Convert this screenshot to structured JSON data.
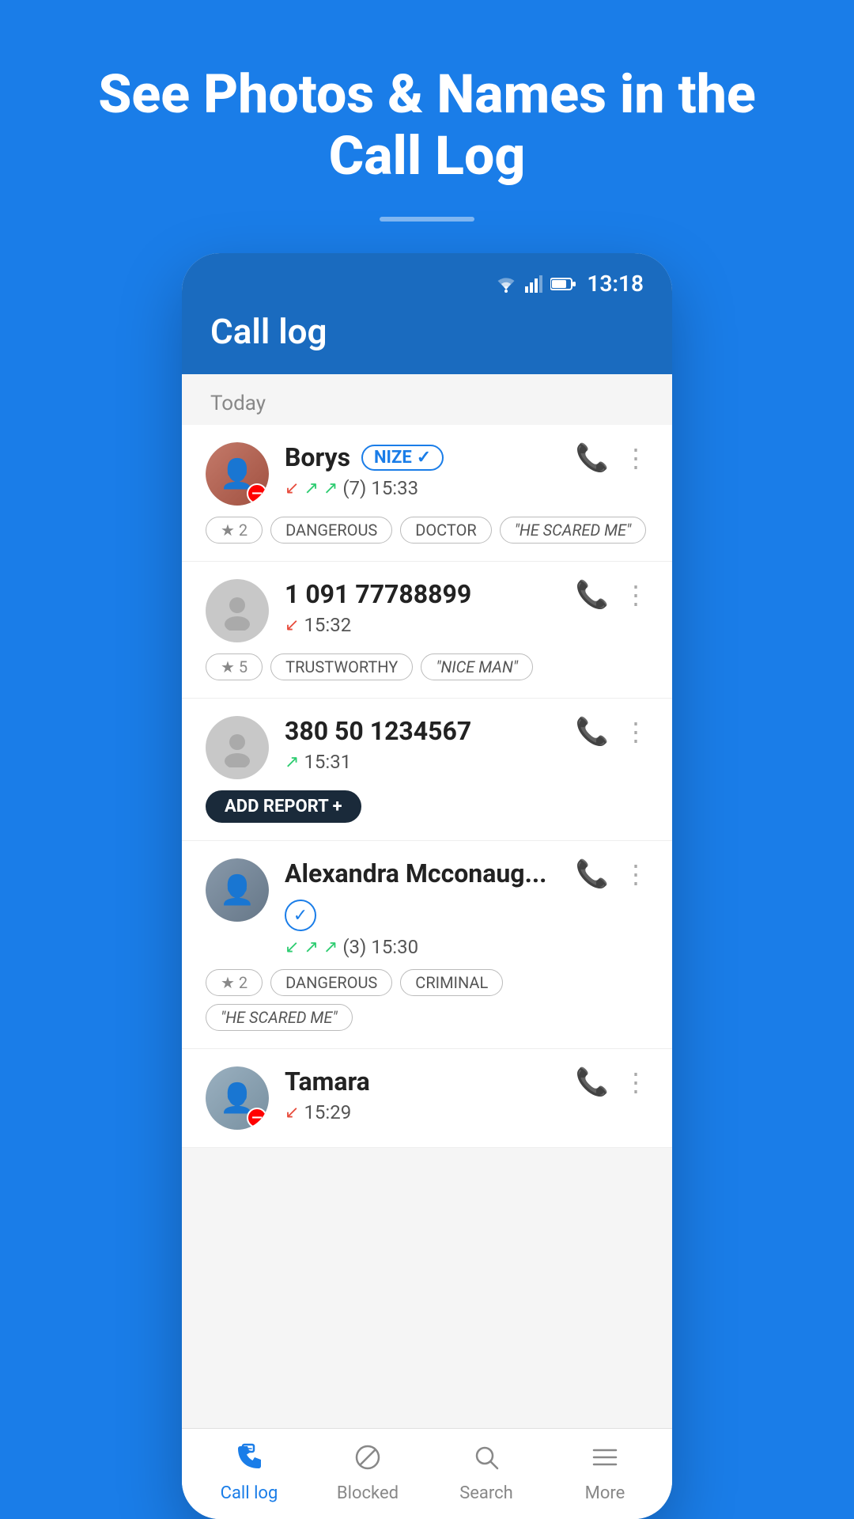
{
  "hero": {
    "title": "See Photos & Names in the Call Log"
  },
  "phone": {
    "statusBar": {
      "time": "13:18"
    },
    "header": {
      "title": "Call log"
    },
    "sectionLabel": "Today",
    "callItems": [
      {
        "id": "borys",
        "name": "Borys",
        "badge": "NIZE ✓",
        "hasBadge": true,
        "badgeType": "nize",
        "isBlocked": true,
        "callMeta": "(7) 15:33",
        "callTypes": [
          "missed-in",
          "out",
          "out"
        ],
        "tags": [
          {
            "type": "star",
            "value": "★ 2"
          },
          {
            "type": "label",
            "value": "DANGEROUS"
          },
          {
            "type": "label",
            "value": "DOCTOR"
          },
          {
            "type": "quote",
            "value": "\"HE SCARED ME\""
          }
        ],
        "hasAvatar": true,
        "avatarType": "borys"
      },
      {
        "id": "unknown1",
        "name": "1 091 77788899",
        "badge": null,
        "hasBadge": false,
        "isBlocked": false,
        "callMeta": "15:32",
        "callTypes": [
          "missed-in"
        ],
        "tags": [
          {
            "type": "star",
            "value": "★ 5"
          },
          {
            "type": "label",
            "value": "TRUSTWORTHY"
          },
          {
            "type": "quote",
            "value": "\"NICE MAN\""
          }
        ],
        "hasAvatar": false,
        "avatarType": "generic"
      },
      {
        "id": "unknown2",
        "name": "380 50 1234567",
        "badge": null,
        "hasBadge": false,
        "isBlocked": false,
        "callMeta": "15:31",
        "callTypes": [
          "out"
        ],
        "tags": [],
        "hasAddReport": true,
        "addReportLabel": "ADD REPORT +",
        "hasAvatar": false,
        "avatarType": "generic"
      },
      {
        "id": "alexandra",
        "name": "Alexandra Mcconaug...",
        "badge": "✓",
        "hasBadge": true,
        "badgeType": "verified",
        "isBlocked": false,
        "callMeta": "(3) 15:30",
        "callTypes": [
          "in",
          "out",
          "out"
        ],
        "tags": [
          {
            "type": "star",
            "value": "★ 2"
          },
          {
            "type": "label",
            "value": "DANGEROUS"
          },
          {
            "type": "label",
            "value": "CRIMINAL"
          },
          {
            "type": "quote",
            "value": "\"HE SCARED ME\""
          }
        ],
        "hasAvatar": true,
        "avatarType": "alexandra"
      },
      {
        "id": "tamara",
        "name": "Tamara",
        "badge": null,
        "hasBadge": false,
        "isBlocked": true,
        "callMeta": "15:29",
        "callTypes": [
          "missed-in"
        ],
        "tags": [],
        "hasAvatar": true,
        "avatarType": "tamara"
      }
    ],
    "bottomNav": [
      {
        "id": "calllog",
        "label": "Call log",
        "icon": "📞",
        "active": true
      },
      {
        "id": "blocked",
        "label": "Blocked",
        "icon": "⊘",
        "active": false
      },
      {
        "id": "search",
        "label": "Search",
        "icon": "🔍",
        "active": false
      },
      {
        "id": "more",
        "label": "More",
        "icon": "☰",
        "active": false
      }
    ]
  }
}
